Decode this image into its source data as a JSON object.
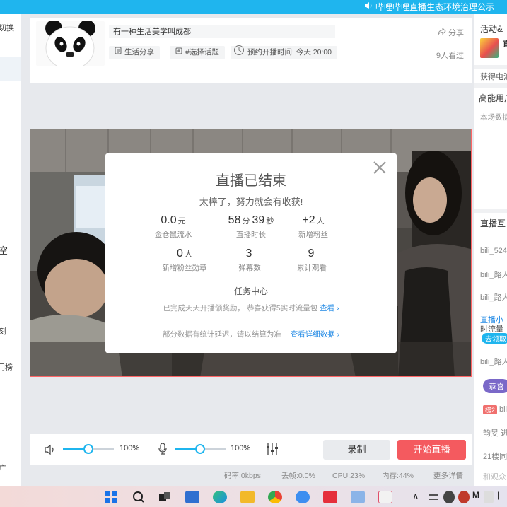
{
  "top_notice": "哔哩哔哩直播生态环境治理公示",
  "left_sidebar": {
    "switch_label": "切换",
    "mid_label": "空",
    "item_a": "刻",
    "item_b": "门榜",
    "item_c": "广"
  },
  "room": {
    "title": "有一种生活美学叫成都",
    "share_label": "分享",
    "category_tag": "生活分享",
    "topic_tag": "#选择话题",
    "schedule_tag": "预约开播时间: 今天 20:00",
    "viewers": "9人看过"
  },
  "modal": {
    "title": "直播已结束",
    "subtitle": "太棒了，努力就会有收获!",
    "stats": [
      {
        "value": "0.0",
        "unit": "元",
        "label": "金仓鼠流水"
      },
      {
        "value": "58",
        "unit": "分",
        "value2": "39",
        "unit2": "秒",
        "label": "直播时长"
      },
      {
        "value": "+2",
        "unit": "人",
        "label": "新增粉丝"
      },
      {
        "value": "0",
        "unit": "人",
        "label": "新增粉丝勋章"
      },
      {
        "value": "3",
        "unit": "",
        "label": "弹幕数"
      },
      {
        "value": "9",
        "unit": "",
        "label": "累计观看"
      }
    ],
    "task_title": "任务中心",
    "task_desc": "已完成天天开播领奖励， 恭喜获得5实时流量包",
    "task_link": "查看",
    "delay_note": "部分数据有统计延迟，请以结算为准",
    "details_link": "查看详细数据"
  },
  "controls": {
    "speaker_volume": "100%",
    "speaker_level": 0.5,
    "mic_volume": "100%",
    "mic_level": 0.5,
    "record_label": "录制",
    "start_label": "开始直播"
  },
  "status": {
    "bitrate": "码率:0kbps",
    "frame_loss": "丢帧:0.0%",
    "cpu": "CPU:23%",
    "memory": "内存:44%",
    "more": "更多详情"
  },
  "right_panel": {
    "activity_title": "活动&",
    "activity_badge": "直",
    "reward": "获得电池",
    "high_energy": "高能用户",
    "data_note": "本场数据",
    "interaction": "直播互",
    "msg1": "bili_524",
    "msg2": "bili_路人",
    "msg3": "bili_路人",
    "tip_link": "直播小",
    "tip_text": "时流量",
    "tip_btn": "去领取",
    "msg4": "bili_路人",
    "congrats_pill": "恭喜",
    "level_badge": "榜2",
    "msg5_name": "bili",
    "msg6": "韵旻 进",
    "msg7": "21楼同",
    "msg8": "和观众"
  },
  "colors": {
    "accent": "#1fb5ee",
    "start_button": "#f45a5f",
    "link": "#1e88e5"
  }
}
